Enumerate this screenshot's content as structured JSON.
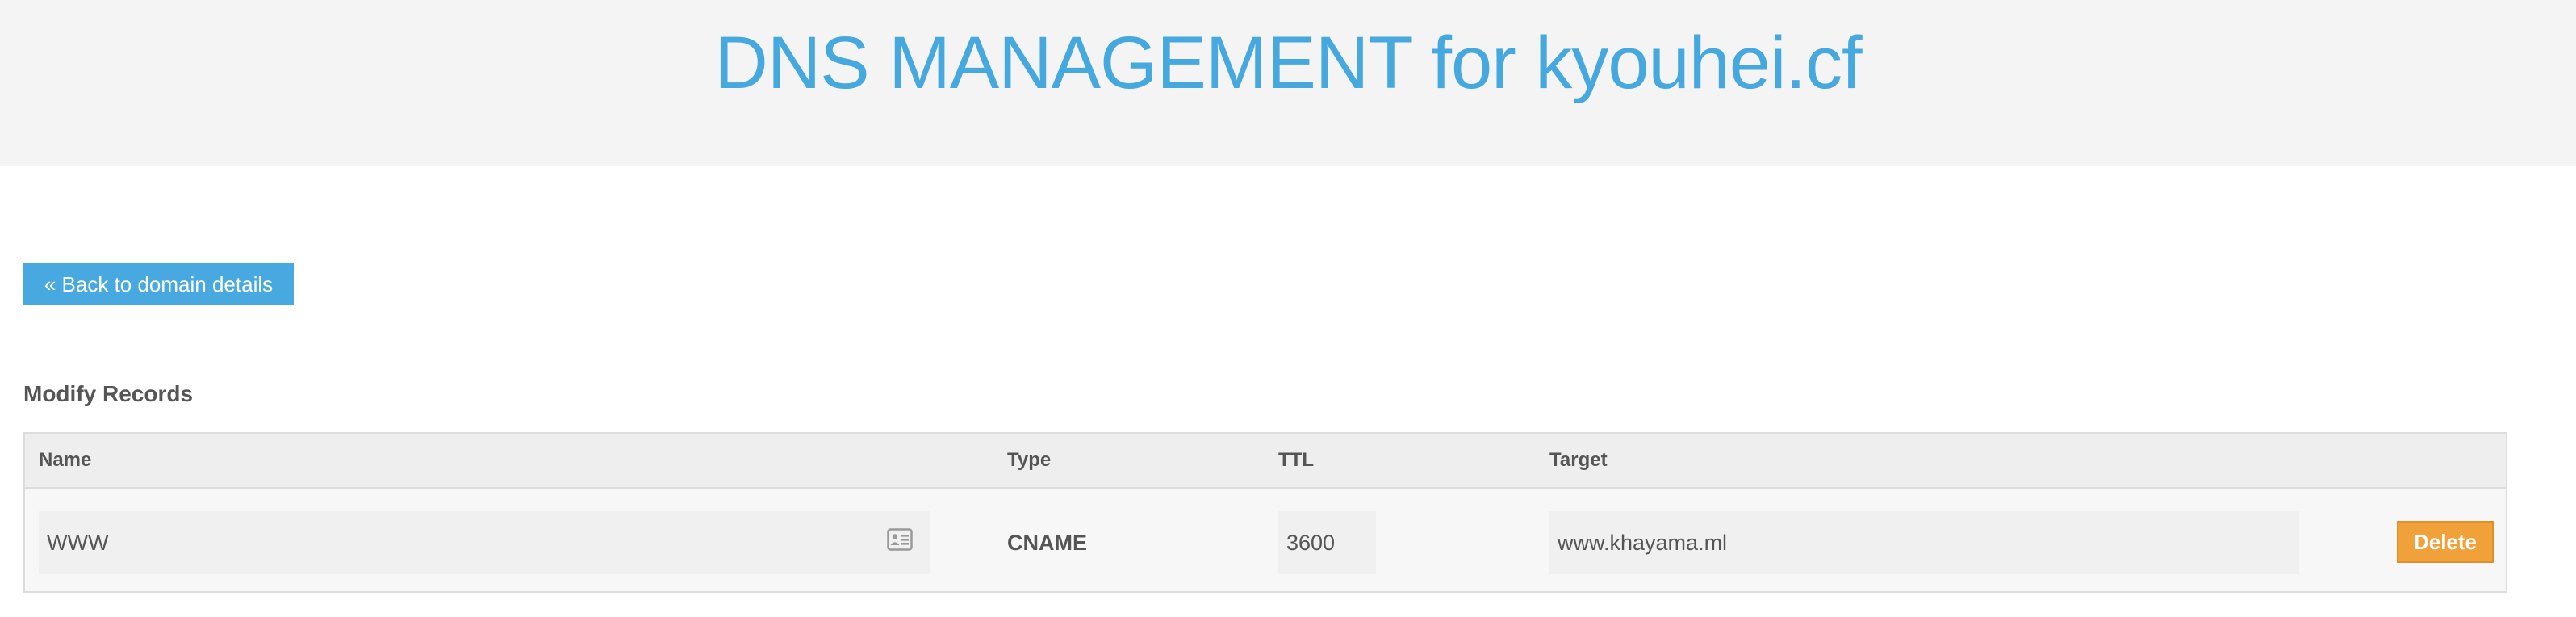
{
  "header": {
    "title": "DNS MANAGEMENT for kyouhei.cf"
  },
  "actions": {
    "back_label": "« Back to domain details"
  },
  "records": {
    "section_title": "Modify Records",
    "columns": {
      "name": "Name",
      "type": "Type",
      "ttl": "TTL",
      "target": "Target"
    },
    "rows": [
      {
        "name": "WWW",
        "type": "CNAME",
        "ttl": "3600",
        "target": "www.khayama.ml",
        "delete_label": "Delete"
      }
    ]
  },
  "icons": {
    "name_field_icon": "contact-card-icon"
  },
  "colors": {
    "title": "#45a8de",
    "primary_button": "#47a9e0",
    "delete_button": "#f0a13a",
    "header_bg": "#f4f4f4"
  }
}
